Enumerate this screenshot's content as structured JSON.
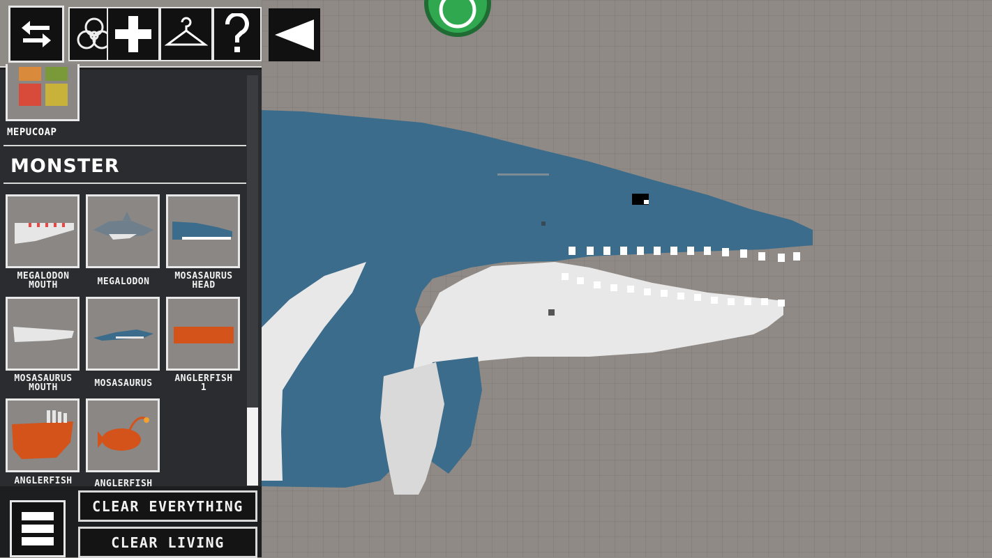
{
  "toolbar": {
    "buttons": [
      {
        "name": "swap-icon"
      },
      {
        "name": "biohazard-icon"
      },
      {
        "name": "plus-icon"
      },
      {
        "name": "hanger-icon"
      },
      {
        "name": "question-icon"
      }
    ],
    "back": {
      "name": "back-arrow-icon"
    }
  },
  "sidebar": {
    "previous_item_label": "MEPUCOAP",
    "category_title": "MONSTER",
    "items": [
      {
        "label": "MEGALODON\nMOUTH"
      },
      {
        "label": "MEGALODON"
      },
      {
        "label": "MOSASAURUS\nHEAD"
      },
      {
        "label": "MOSASAURUS\nMOUTH"
      },
      {
        "label": "MOSASAURUS"
      },
      {
        "label": "ANGLERFISH\n1"
      },
      {
        "label": "ANGLERFISH"
      },
      {
        "label": "ANGLERFISH"
      }
    ]
  },
  "bottom": {
    "clear_everything": "CLEAR EVERYTHING",
    "clear_living": "CLEAR LIVING"
  },
  "colors": {
    "creature_blue": "#3b6c8b",
    "creature_white": "#e6e6e6",
    "panel": "#2a2c2f",
    "sandbox": "#8f8a85",
    "anglerfish_orange": "#d4531b",
    "whatsapp_green": "#2fa84f"
  },
  "icons": {
    "overlay": "whatsapp-icon",
    "menu": "hamburger-icon"
  }
}
